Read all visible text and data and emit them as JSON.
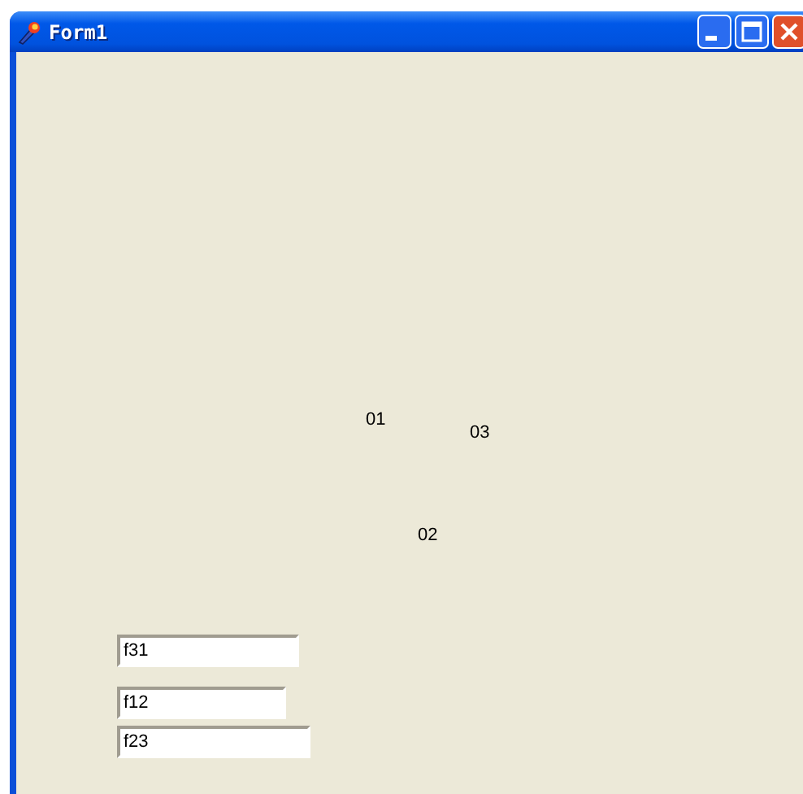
{
  "window": {
    "title": "Form1"
  },
  "labels": [
    "01",
    "03",
    "02"
  ],
  "text_boxes": [
    {
      "value": "f31"
    },
    {
      "value": "f12"
    },
    {
      "value": "f23"
    }
  ]
}
